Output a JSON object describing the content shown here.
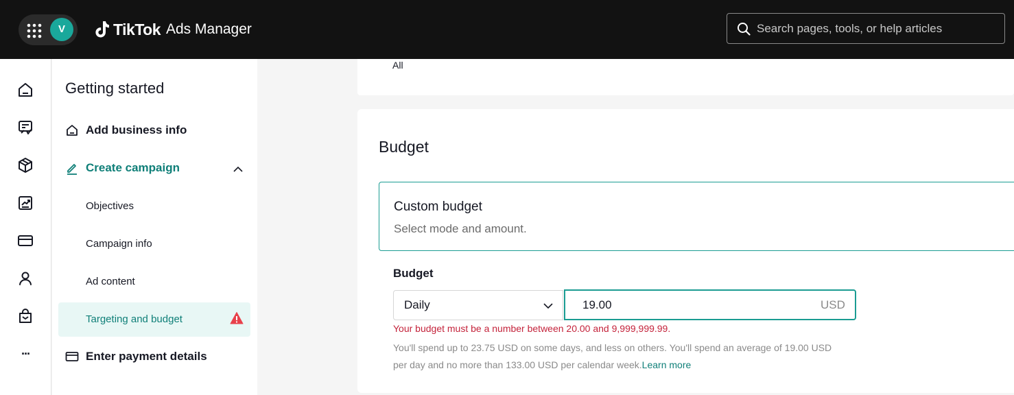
{
  "header": {
    "avatar_initial": "V",
    "brand_name": "TikTok",
    "brand_product": "Ads Manager",
    "search_placeholder": "Search pages, tools, or help articles"
  },
  "rail": {
    "items": [
      "home-icon",
      "campaign-icon",
      "box-icon",
      "analytics-icon",
      "payment-card-icon",
      "person-icon",
      "shopping-bag-icon",
      "more-icon"
    ],
    "more_label": "···"
  },
  "sidebar": {
    "title": "Getting started",
    "steps": [
      {
        "label": "Add business info",
        "icon": "house-icon"
      },
      {
        "label": "Create campaign",
        "icon": "pencil-icon",
        "active": true
      },
      {
        "label": "Enter payment details",
        "icon": "card-icon"
      }
    ],
    "substeps": [
      "Objectives",
      "Campaign info",
      "Ad content",
      "Targeting and budget"
    ],
    "active_substep": "Targeting and budget"
  },
  "main": {
    "top_card_text": "All",
    "budget": {
      "title": "Budget",
      "option_title": "Custom budget",
      "option_subtitle": "Select mode and amount.",
      "field_label": "Budget",
      "mode": "Daily",
      "amount": "19.00",
      "currency": "USD",
      "error": "Your budget must be a number between 20.00 and 9,999,999.99.",
      "help_text": "You'll spend up to 23.75 USD on some days, and less on others. You'll spend an average of 19.00 USD per day and no more than 133.00 USD per calendar week.",
      "learn_more": "Learn more"
    }
  },
  "colors": {
    "accent": "#0f7f78",
    "error": "#c4233b",
    "topbar": "#121212",
    "warning": "#e8414b"
  }
}
